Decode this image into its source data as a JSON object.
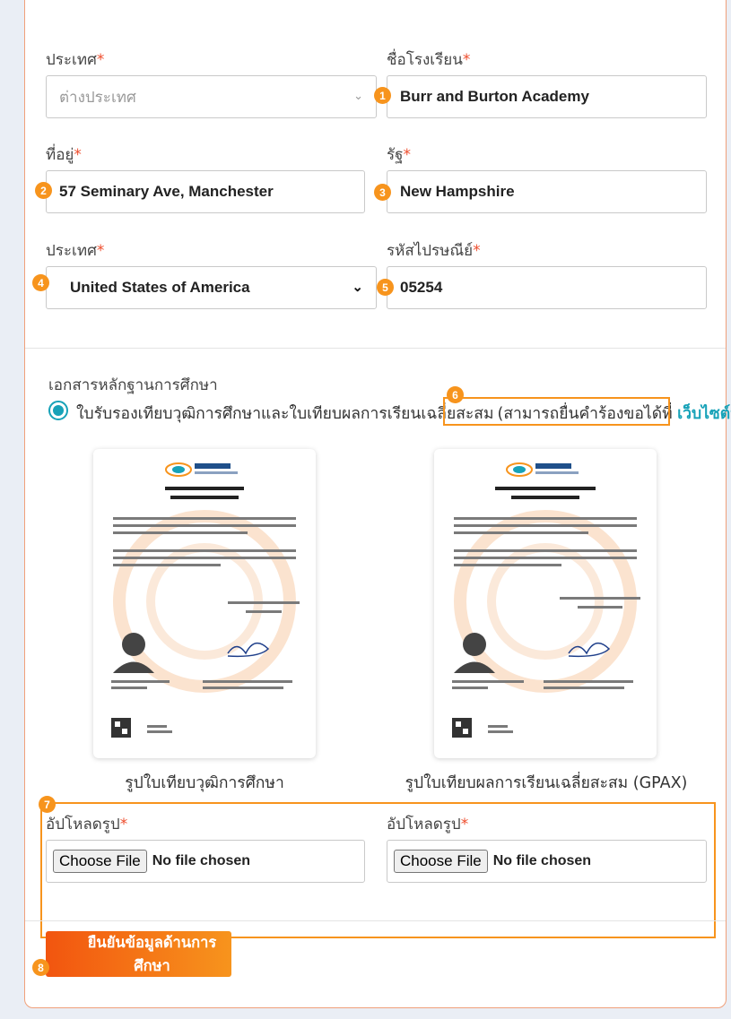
{
  "address": {
    "country_label": "ประเทศ",
    "country_disabled_value": "ต่างประเทศ",
    "school_label": "ชื่อโรงเรียน",
    "school_value": "Burr and Burton Academy",
    "address_label": "ที่อยู่",
    "address_value": "57 Seminary Ave, Manchester",
    "state_label": "รัฐ",
    "state_value": "New Hampshire",
    "country2_label": "ประเทศ",
    "country2_value": "United States of America",
    "postal_label": "รหัสไปรษณีย์",
    "postal_value": "05254",
    "required_mark": "*"
  },
  "documents": {
    "section_title": "เอกสารหลักฐานการศึกษา",
    "option_label": "ใบรับรองเทียบวุฒิการศึกษาและใบเทียบผลการเรียนเฉลี่ยสะสม",
    "apply_text": "(สามารถยื่นคำร้องขอได้ที่ ",
    "apply_link": "เว็บไซต์นี้",
    "apply_close": ")",
    "doc1": {
      "logo_text": "ทปอ",
      "title": "ใบรับรองเทียบวุฒิการศึกษา",
      "subtitle": "สำหรับระบบ TCAS65",
      "caption": "รูปใบเทียบวุฒิการศึกษา"
    },
    "doc2": {
      "logo_text": "ทปอ",
      "title": "ใบเทียบผลการเรียนเฉลี่ยสะสม (GPAX)",
      "subtitle": "สำหรับระบบ TCAS65",
      "caption": "รูปใบเทียบผลการเรียนเฉลี่ยสะสม (GPAX)"
    },
    "upload1_label": "อัปโหลดรูป",
    "upload2_label": "อัปโหลดรูป",
    "choose_file": "Choose File",
    "no_file": "No file chosen"
  },
  "submit_label": "ยืนยันข้อมูลด้านการศึกษา",
  "badges": [
    "1",
    "2",
    "3",
    "4",
    "5",
    "6",
    "7",
    "8"
  ],
  "colors": {
    "accent": "#f7941d",
    "link": "#17a2b8",
    "submit_start": "#f2550f",
    "required": "#ee4d2d"
  }
}
